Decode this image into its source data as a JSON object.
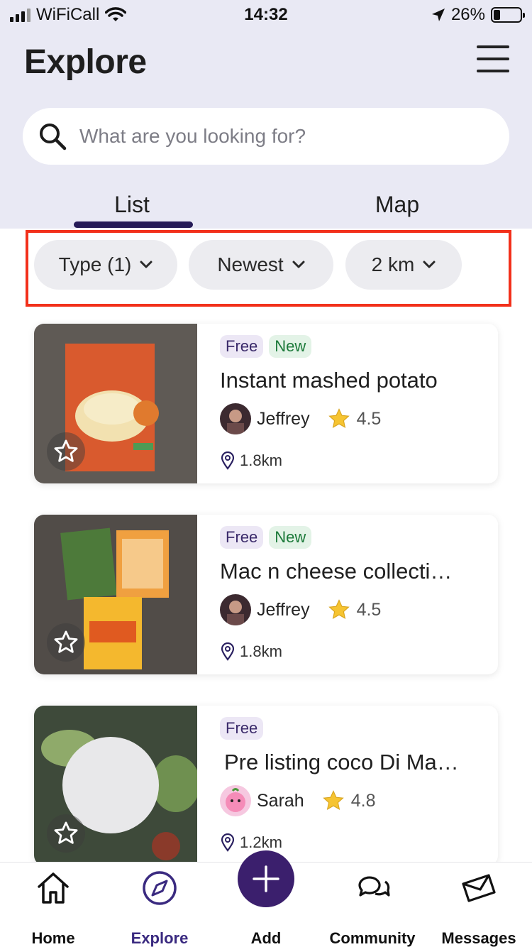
{
  "status_bar": {
    "carrier": "WiFiCall",
    "time": "14:32",
    "battery": "26%"
  },
  "header": {
    "title": "Explore",
    "menu_icon": "hamburger-icon"
  },
  "search": {
    "placeholder": "What are you looking for?",
    "value": "",
    "icon": "search-icon"
  },
  "tabs": [
    {
      "label": "List",
      "active": true
    },
    {
      "label": "Map",
      "active": false
    }
  ],
  "filters": [
    {
      "label": "Type (1)"
    },
    {
      "label": "Newest"
    },
    {
      "label": "2 km"
    }
  ],
  "listings": [
    {
      "badges": [
        "Free",
        "New"
      ],
      "title": "Instant mashed potato",
      "user": "Jeffrey",
      "rating": "4.5",
      "distance": "1.8km"
    },
    {
      "badges": [
        "Free",
        "New"
      ],
      "title": "Mac n cheese collecti…",
      "user": "Jeffrey",
      "rating": "4.5",
      "distance": "1.8km"
    },
    {
      "badges": [
        "Free"
      ],
      "title": "Pre listing coco Di Ma…",
      "user": "Sarah",
      "rating": "4.8",
      "distance": "1.2km"
    }
  ],
  "tabbar": {
    "items": [
      {
        "label": "Home",
        "icon": "home-icon"
      },
      {
        "label": "Explore",
        "icon": "compass-icon",
        "active": true
      },
      {
        "label": "Add",
        "icon": "plus-icon"
      },
      {
        "label": "Community",
        "icon": "chat-icon"
      },
      {
        "label": "Messages",
        "icon": "envelope-icon"
      }
    ]
  },
  "colors": {
    "header_bg": "#e9e9f4",
    "accent": "#3b1f6d",
    "highlight_border": "#f2301b"
  }
}
